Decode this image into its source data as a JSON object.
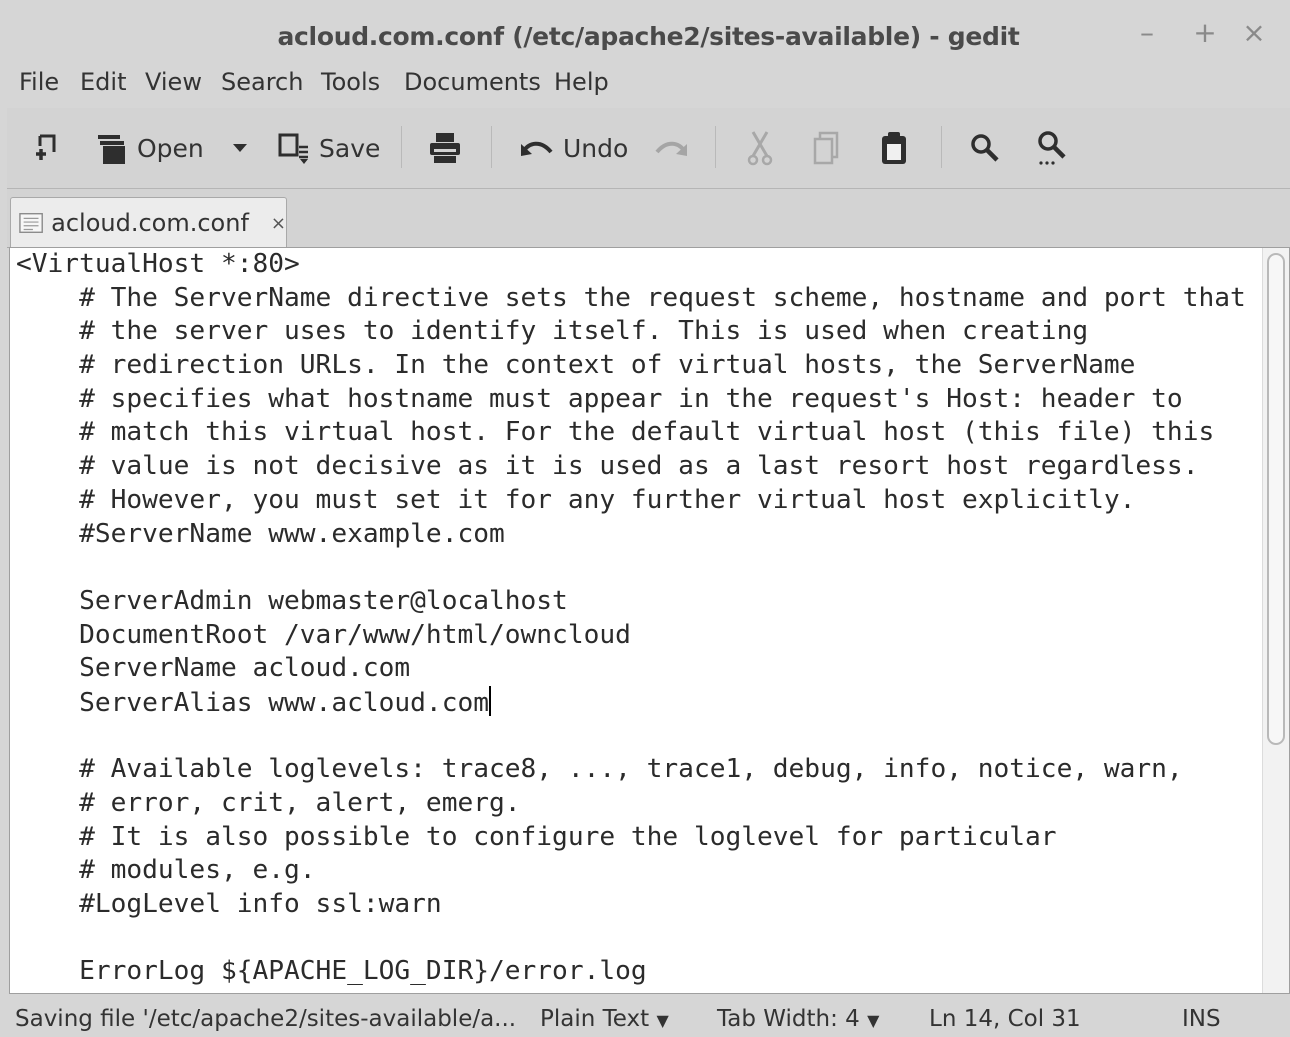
{
  "window": {
    "title": "acloud.com.conf (/etc/apache2/sites-available) - gedit",
    "controls": {
      "minimize": "–",
      "maximize": "+",
      "close": "×"
    }
  },
  "menubar": [
    "File",
    "Edit",
    "View",
    "Search",
    "Tools",
    "Documents",
    "Help"
  ],
  "toolbar": {
    "open_label": "Open",
    "save_label": "Save",
    "undo_label": "Undo"
  },
  "tab": {
    "label": "acloud.com.conf",
    "close": "×"
  },
  "editor": {
    "lines": [
      "<VirtualHost *:80>",
      "\t# The ServerName directive sets the request scheme, hostname and port that",
      "\t# the server uses to identify itself. This is used when creating",
      "\t# redirection URLs. In the context of virtual hosts, the ServerName",
      "\t# specifies what hostname must appear in the request's Host: header to",
      "\t# match this virtual host. For the default virtual host (this file) this",
      "\t# value is not decisive as it is used as a last resort host regardless.",
      "\t# However, you must set it for any further virtual host explicitly.",
      "\t#ServerName www.example.com",
      "",
      "\tServerAdmin webmaster@localhost",
      "\tDocumentRoot /var/www/html/owncloud",
      "\tServerName acloud.com",
      "\tServerAlias www.acloud.com",
      "",
      "\t# Available loglevels: trace8, ..., trace1, debug, info, notice, warn,",
      "\t# error, crit, alert, emerg.",
      "\t# It is also possible to configure the loglevel for particular",
      "\t# modules, e.g.",
      "\t#LogLevel info ssl:warn",
      "",
      "\tErrorLog ${APACHE_LOG_DIR}/error.log"
    ],
    "cursor_line": 14
  },
  "statusbar": {
    "message": "Saving file '/etc/apache2/sites-available/a...",
    "language": "Plain Text",
    "tab_width": "Tab Width: 4",
    "position": "Ln 14, Col 31",
    "mode": "INS"
  }
}
